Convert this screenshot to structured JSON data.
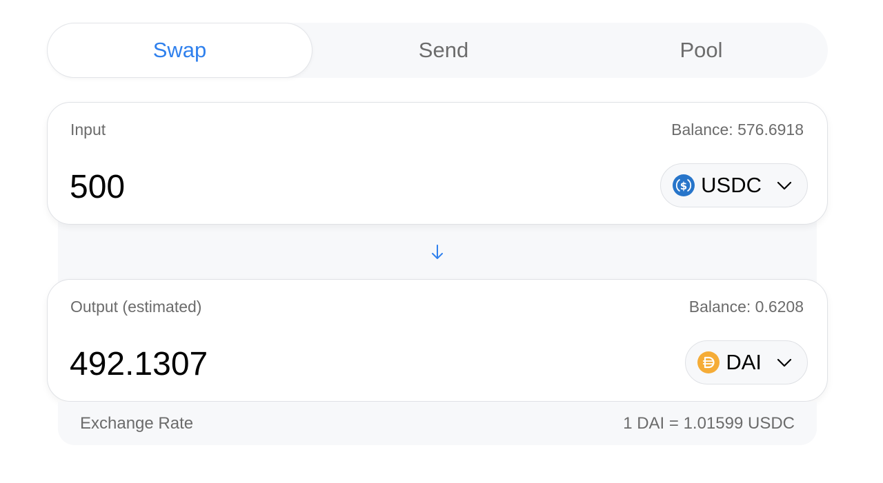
{
  "tabs": [
    {
      "label": "Swap",
      "active": true
    },
    {
      "label": "Send",
      "active": false
    },
    {
      "label": "Pool",
      "active": false
    }
  ],
  "input": {
    "label": "Input",
    "balance": "Balance: 576.6918",
    "amount": "500",
    "token": {
      "symbol": "USDC",
      "icon": "usdc-icon",
      "color": "#2775ca"
    }
  },
  "swap_direction_icon": "arrow-down-icon",
  "output": {
    "label": "Output (estimated)",
    "balance": "Balance: 0.6208",
    "amount": "492.1307",
    "token": {
      "symbol": "DAI",
      "icon": "dai-icon",
      "color": "#f5ac37"
    }
  },
  "exchange_rate": {
    "label": "Exchange Rate",
    "value": "1 DAI = 1.01599 USDC"
  },
  "colors": {
    "accent": "#2f80ed",
    "muted_text": "#6b6b6b",
    "panel_bg": "#f7f8fa"
  }
}
